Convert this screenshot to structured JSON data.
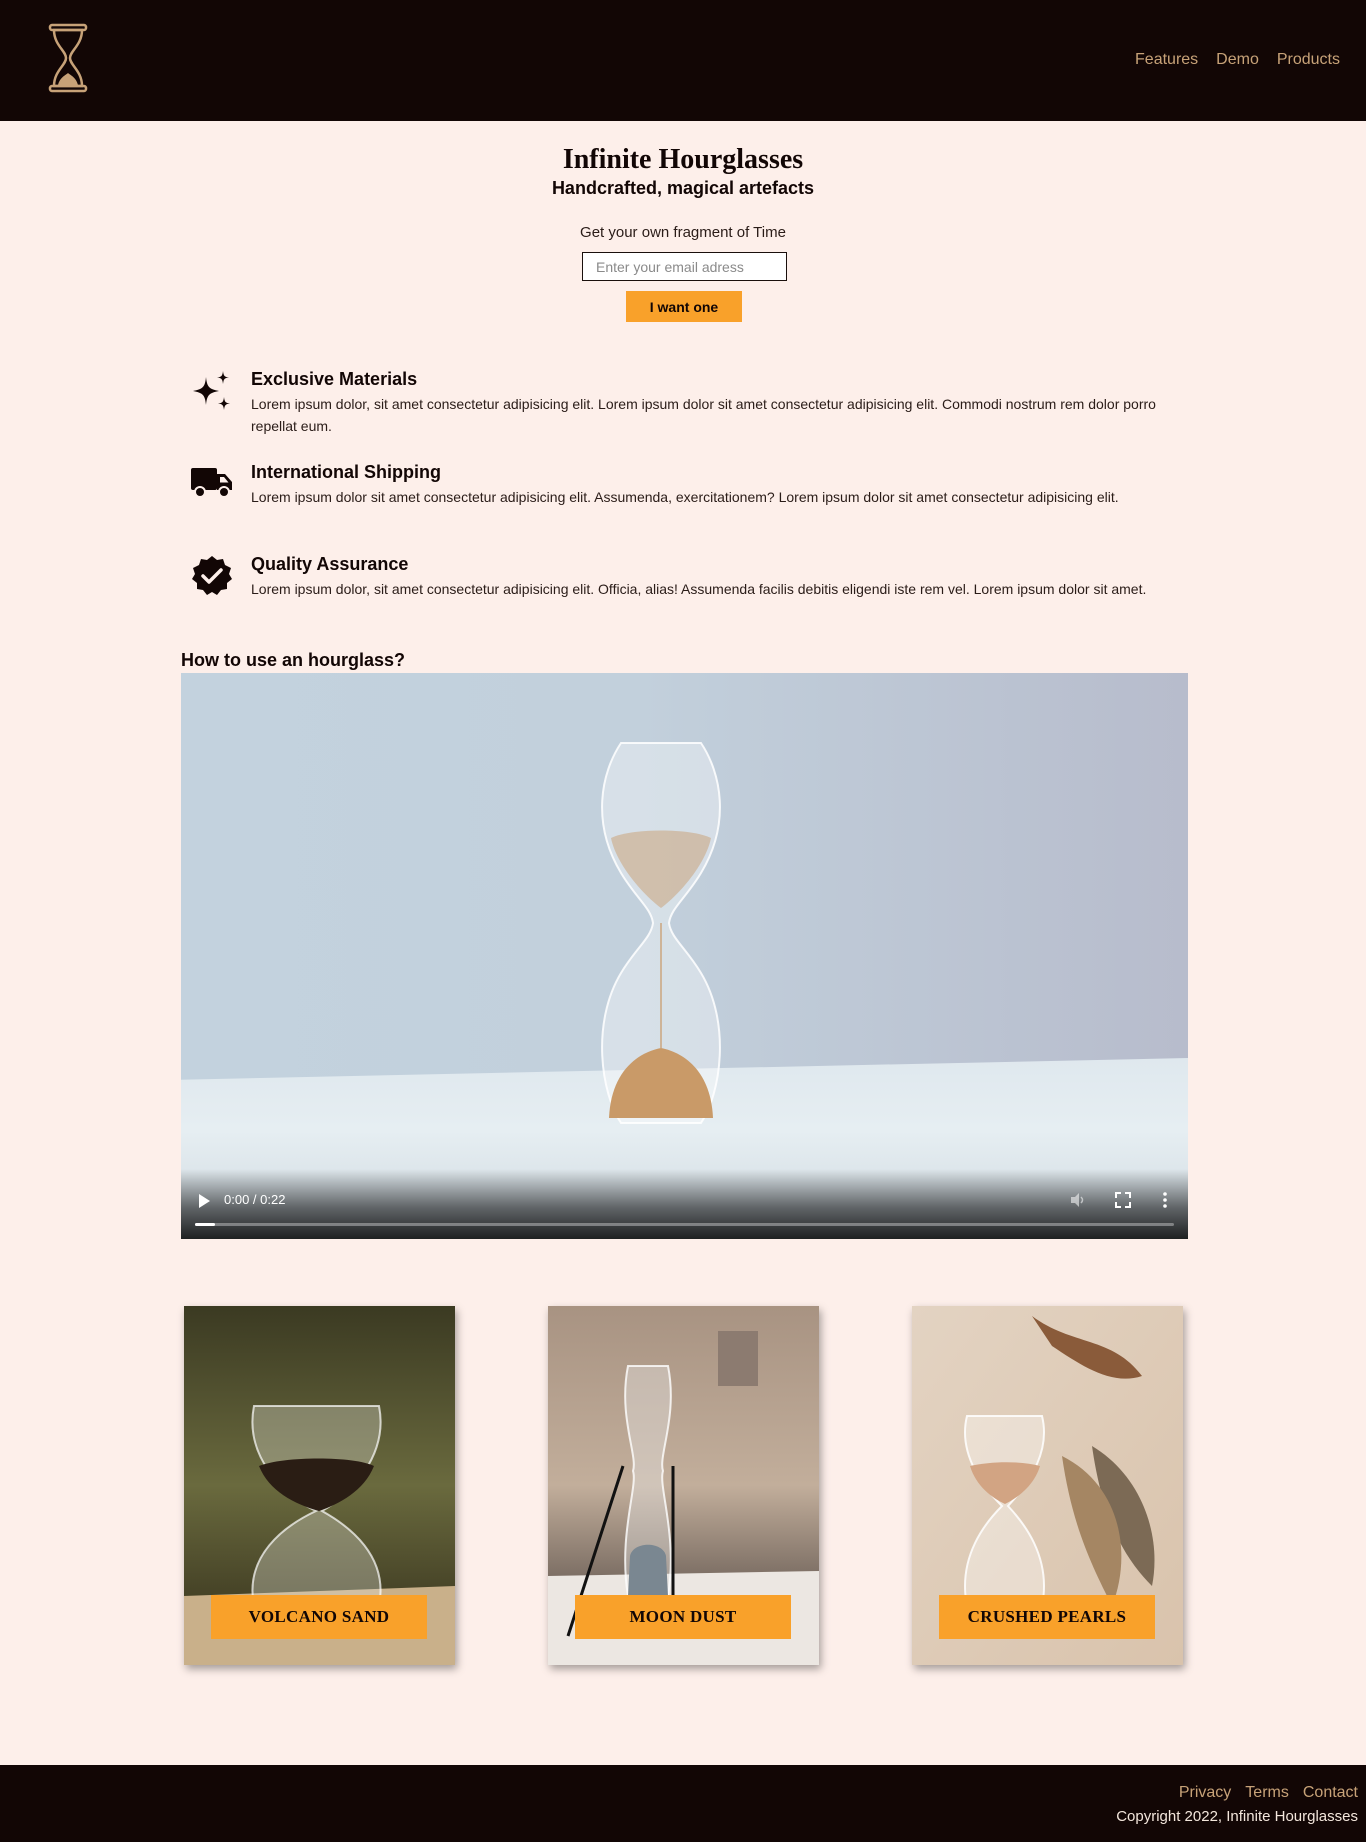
{
  "header": {
    "logo": "hourglass-logo-icon",
    "nav": [
      "Features",
      "Demo",
      "Products"
    ]
  },
  "hero": {
    "title": "Infinite Hourglasses",
    "subtitle": "Handcrafted, magical artefacts",
    "cta_text": "Get your own fragment of Time",
    "email_placeholder": "Enter your email adress",
    "button_label": "I want one"
  },
  "features": [
    {
      "icon": "sparkles-icon",
      "title": "Exclusive Materials",
      "description": "Lorem ipsum dolor, sit amet consectetur adipisicing elit. Lorem ipsum dolor sit amet consectetur adipisicing elit. Commodi nostrum rem dolor porro repellat eum."
    },
    {
      "icon": "truck-icon",
      "title": "International Shipping",
      "description": "Lorem ipsum dolor sit amet consectetur adipisicing elit. Assumenda, exercitationem? Lorem ipsum dolor sit amet consectetur adipisicing elit."
    },
    {
      "icon": "verified-badge-icon",
      "title": "Quality Assurance",
      "description": "Lorem ipsum dolor, sit amet consectetur adipisicing elit. Officia, alias! Assumenda facilis debitis eligendi iste rem vel. Lorem ipsum dolor sit amet."
    }
  ],
  "video_section": {
    "title": "How to use an hourglass?",
    "time": "0:00 / 0:22",
    "progress": 0.02
  },
  "products": [
    "VOLCANO SAND",
    "MOON DUST",
    "CRUSHED PEARLS"
  ],
  "footer": {
    "links": [
      "Privacy",
      "Terms",
      "Contact"
    ],
    "copyright": "Copyright 2022, Infinite Hourglasses"
  },
  "colors": {
    "header_bg": "#120605",
    "page_bg": "#fdefea",
    "accent": "#f9a12a",
    "link": "#c7a278"
  }
}
